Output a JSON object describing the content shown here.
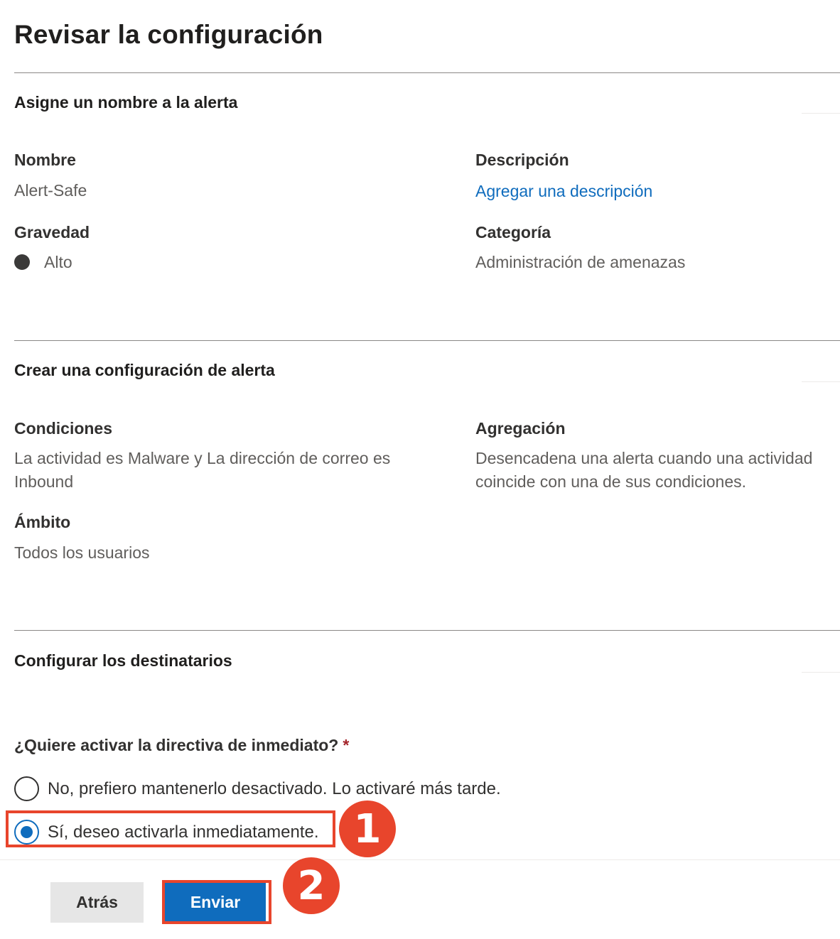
{
  "page": {
    "title": "Revisar la configuración"
  },
  "section_name": {
    "title": "Asigne un nombre a la alerta",
    "name_label": "Nombre",
    "name_value": "Alert-Safe",
    "description_label": "Descripción",
    "description_link": "Agregar una descripción",
    "severity_label": "Gravedad",
    "severity_value": "Alto",
    "category_label": "Categoría",
    "category_value": "Administración de amenazas"
  },
  "section_settings": {
    "title": "Crear una configuración de alerta",
    "conditions_label": "Condiciones",
    "conditions_value_line1": "La actividad es Malware y La dirección de correo es",
    "conditions_value_line2": "Inbound",
    "aggregation_label": "Agregación",
    "aggregation_value_line1": "Desencadena una alerta cuando una actividad",
    "aggregation_value_line2": "coincide con una de sus condiciones.",
    "scope_label": "Ámbito",
    "scope_value": "Todos los usuarios"
  },
  "section_recipients": {
    "title": "Configurar los destinatarios"
  },
  "activation": {
    "question": "¿Quiere activar la directiva de inmediato?",
    "required_mark": "*",
    "options": [
      {
        "label": "No, prefiero mantenerlo desactivado. Lo activaré más tarde.",
        "selected": false
      },
      {
        "label": "Sí, deseo activarla inmediatamente.",
        "selected": true
      }
    ]
  },
  "annotations": {
    "step1": "1",
    "step2": "2",
    "color": "#e8452c"
  },
  "footer": {
    "back_label": "Atrás",
    "submit_label": "Enviar"
  },
  "colors": {
    "accent": "#0f6cbd",
    "severity_dot": "#3b3a39",
    "required": "#a4262c"
  }
}
